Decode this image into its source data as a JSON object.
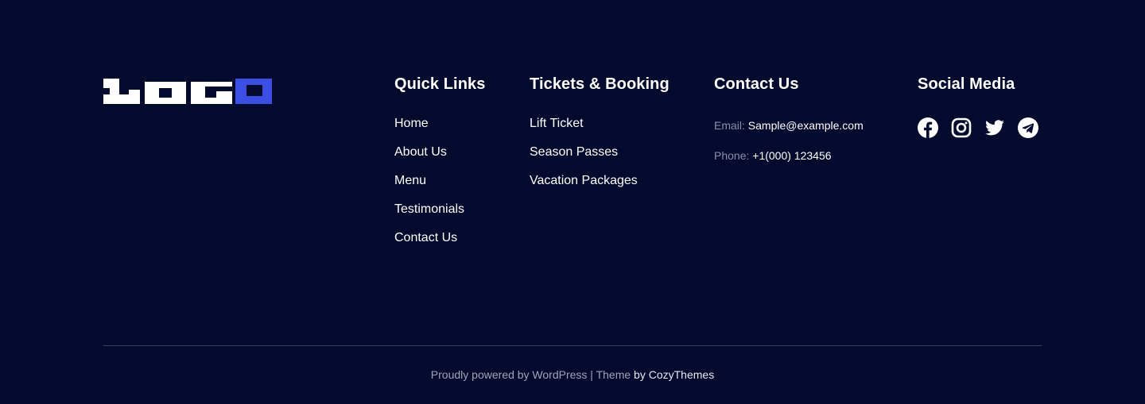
{
  "logo": {
    "text": "LOGO",
    "colors": {
      "main": "#ffffff",
      "accent": "#3b4fe4"
    }
  },
  "quick_links": {
    "heading": "Quick Links",
    "items": [
      "Home",
      "About Us",
      "Menu",
      "Testimonials",
      "Contact Us"
    ]
  },
  "tickets": {
    "heading": "Tickets & Booking",
    "items": [
      "Lift Ticket",
      "Season Passes",
      "Vacation Packages"
    ]
  },
  "contact": {
    "heading": "Contact Us",
    "email_label": "Email:",
    "email_value": "Sample@example.com",
    "phone_label": "Phone:",
    "phone_value": "+1(000) 123456"
  },
  "social": {
    "heading": "Social Media",
    "icons": [
      "facebook-icon",
      "instagram-icon",
      "twitter-icon",
      "telegram-icon"
    ]
  },
  "footer_bottom": {
    "powered": "Proudly powered by WordPress",
    "separator": " | ",
    "theme": "Theme ",
    "by": "by CozyThemes"
  },
  "colors": {
    "background": "#020a2e",
    "divider": "#3a3f5c",
    "muted_text": "#8a8fa8"
  }
}
